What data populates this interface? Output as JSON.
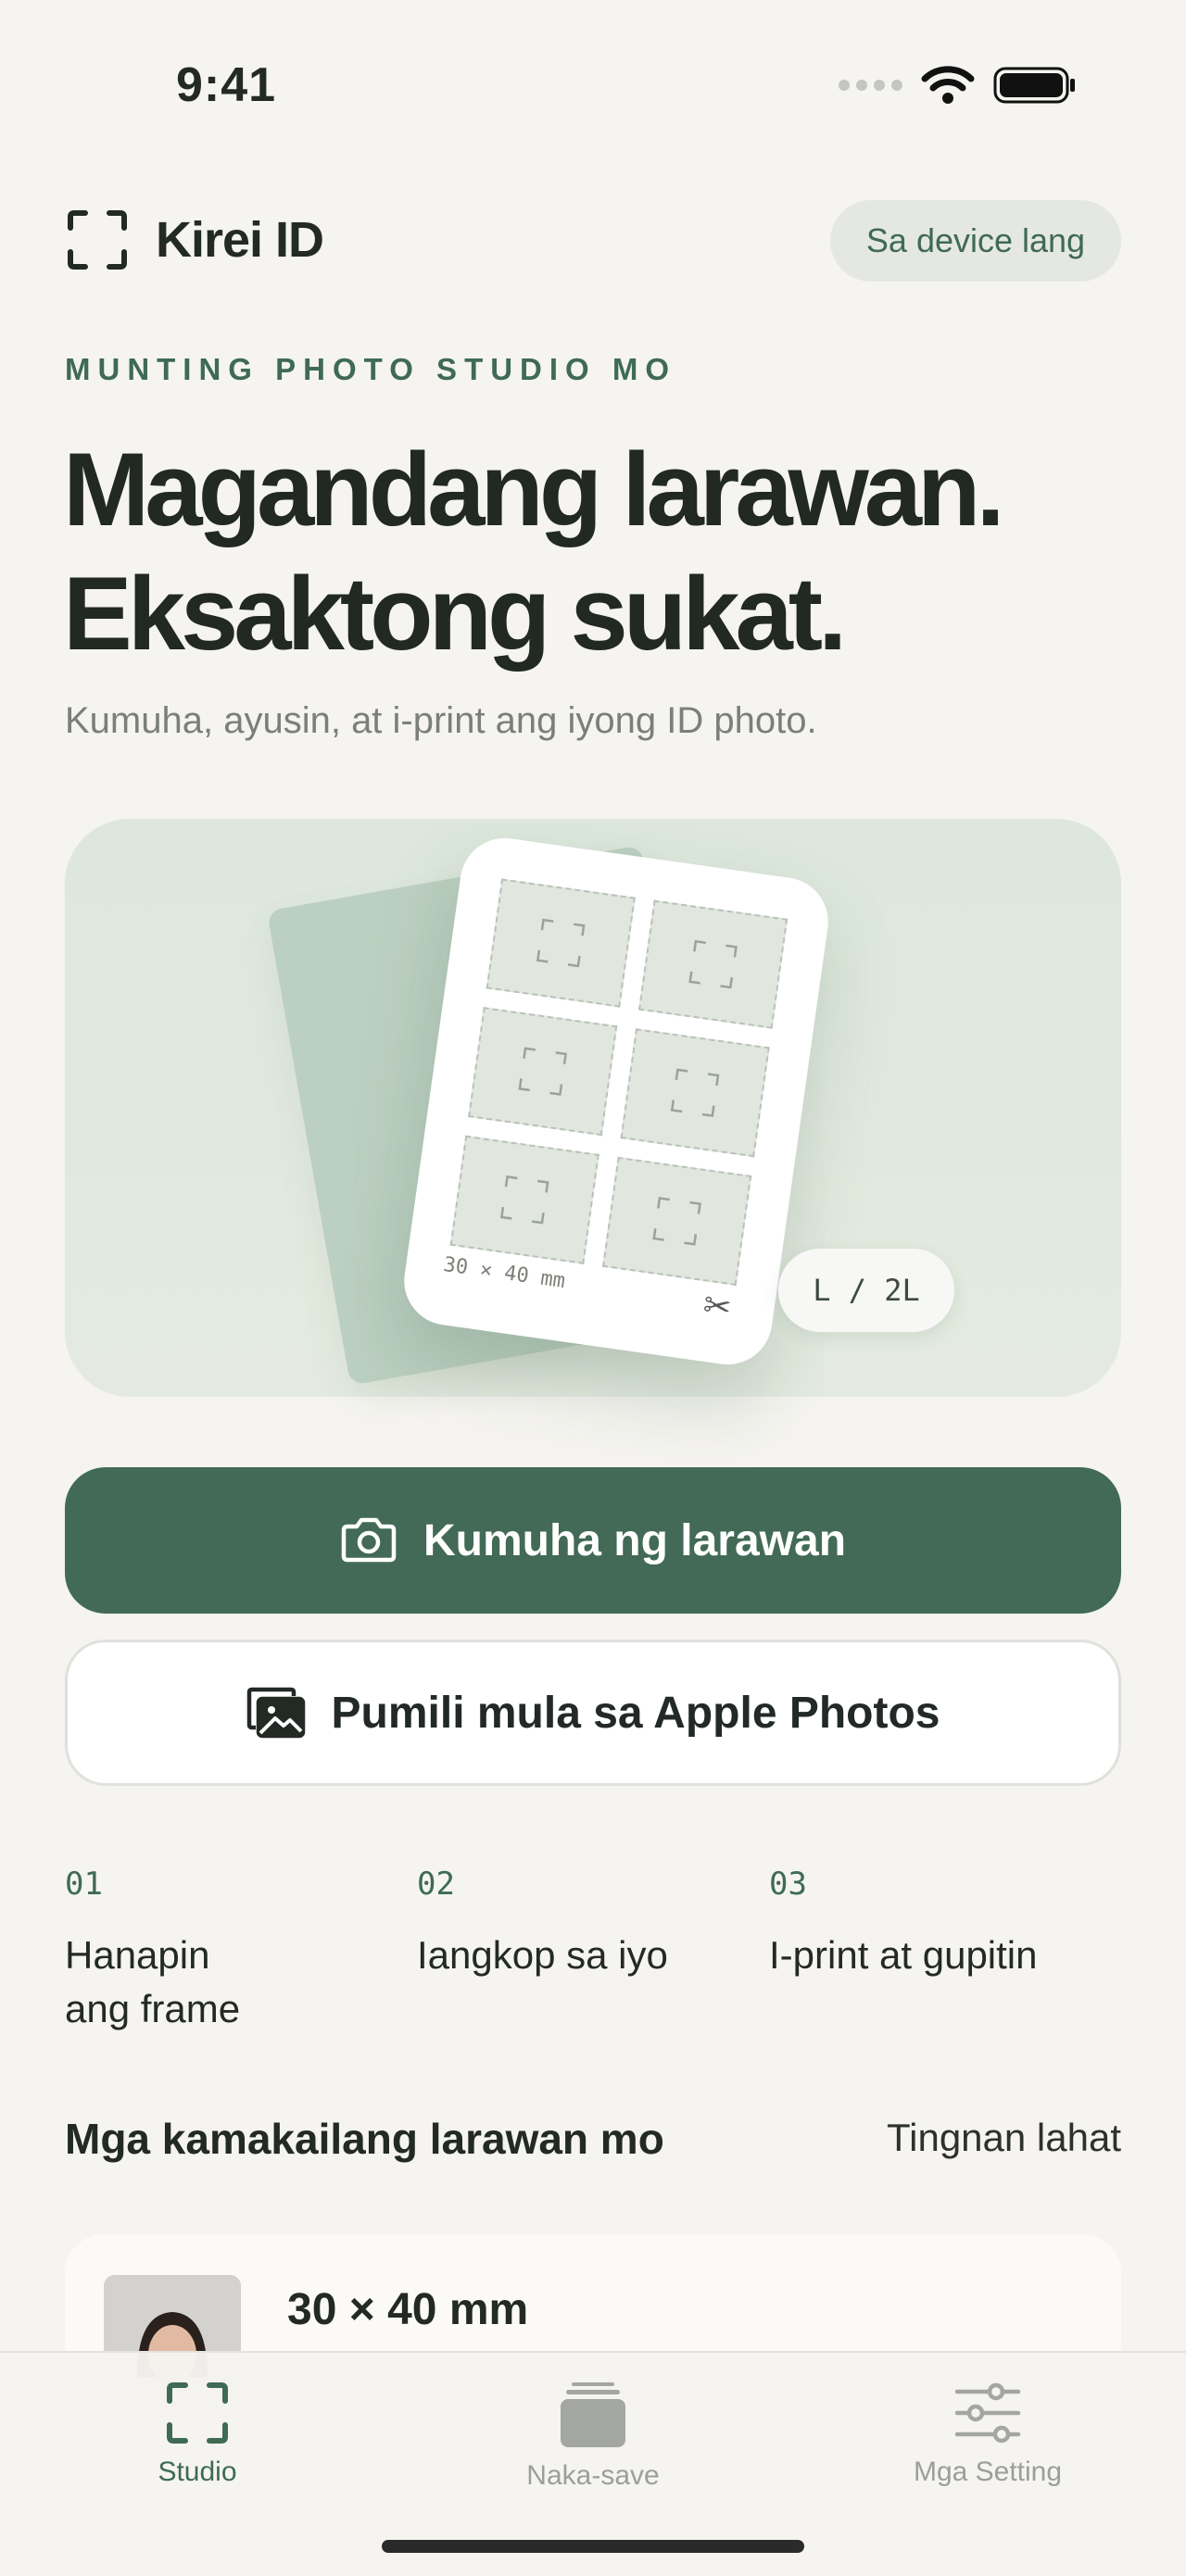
{
  "status_bar": {
    "time": "9:41"
  },
  "header": {
    "app_name": "Kirei ID",
    "device_badge": "Sa device lang"
  },
  "hero_text": {
    "eyebrow": "MUNTING PHOTO STUDIO MO",
    "headline_line1": "Magandang larawan.",
    "headline_line2": "Eksaktong sukat.",
    "subheadline": "Kumuha, ayusin, at i-print ang iyong ID photo."
  },
  "illustration": {
    "photo_size": "30 × 40 mm",
    "paper_size": "L / 2L"
  },
  "actions": {
    "take_photo": "Kumuha ng larawan",
    "pick_photos": "Pumili mula sa Apple Photos"
  },
  "steps": [
    {
      "num": "01",
      "label": "Hanapin ang frame"
    },
    {
      "num": "02",
      "label": "Iangkop sa iyo"
    },
    {
      "num": "03",
      "label": "I-print at gupitin"
    }
  ],
  "recents": {
    "title": "Mga kamakailang larawan mo",
    "see_all": "Tingnan lahat",
    "items": [
      {
        "size": "30 × 40 mm"
      }
    ]
  },
  "tabbar": {
    "tabs": [
      {
        "label": "Studio",
        "icon": "viewfinder-icon",
        "active": true
      },
      {
        "label": "Naka-save",
        "icon": "stack-icon",
        "active": false
      },
      {
        "label": "Mga Setting",
        "icon": "sliders-icon",
        "active": false
      }
    ]
  },
  "colors": {
    "accent": "#426a56",
    "background": "#f5f4f0",
    "hero_bg": "#dde7dc"
  }
}
